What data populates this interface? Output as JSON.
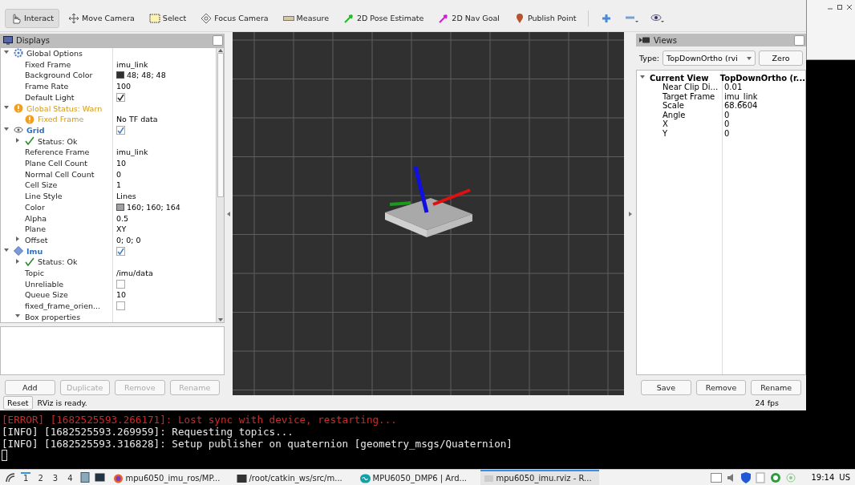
{
  "toolbar": {
    "tools": [
      {
        "kind": "interact",
        "label": "Interact",
        "selected": true
      },
      {
        "kind": "move",
        "label": "Move Camera",
        "selected": false
      },
      {
        "kind": "select",
        "label": "Select",
        "selected": false
      },
      {
        "kind": "focus",
        "label": "Focus Camera",
        "selected": false
      },
      {
        "kind": "measure",
        "label": "Measure",
        "selected": false
      },
      {
        "kind": "pose",
        "label": "2D Pose Estimate",
        "selected": false
      },
      {
        "kind": "nav",
        "label": "2D Nav Goal",
        "selected": false
      },
      {
        "kind": "point",
        "label": "Publish Point",
        "selected": false
      }
    ],
    "icon_tools": [
      {
        "kind": "plus"
      },
      {
        "kind": "minus"
      },
      {
        "kind": "eye"
      }
    ]
  },
  "displays": {
    "title": "Displays",
    "tree": [
      {
        "kind": "options",
        "label": "Global Options",
        "expanded": true,
        "children": [
          {
            "kind": "property",
            "label": "Fixed Frame",
            "value": "imu_link"
          },
          {
            "kind": "property",
            "label": "Background Color",
            "value": "48; 48; 48",
            "color": "#303030"
          },
          {
            "kind": "property",
            "label": "Frame Rate",
            "value": "100"
          },
          {
            "kind": "property",
            "label": "Default Light",
            "checked": true
          }
        ]
      },
      {
        "kind": "warn",
        "label": "Global Status: Warn",
        "expanded": true,
        "children": [
          {
            "kind": "warn",
            "label": "Fixed Frame",
            "value": "No TF data"
          }
        ]
      },
      {
        "kind": "grid",
        "label": "Grid",
        "expanded": true,
        "checked": true,
        "children": [
          {
            "kind": "status",
            "label": "Status: Ok",
            "expanded": false
          },
          {
            "kind": "property",
            "label": "Reference Frame",
            "value": "imu_link"
          },
          {
            "kind": "property",
            "label": "Plane Cell Count",
            "value": "10"
          },
          {
            "kind": "property",
            "label": "Normal Cell Count",
            "value": "0"
          },
          {
            "kind": "property",
            "label": "Cell Size",
            "value": "1"
          },
          {
            "kind": "property",
            "label": "Line Style",
            "value": "Lines"
          },
          {
            "kind": "property",
            "label": "Color",
            "value": "160; 160; 164",
            "color": "#a0a0a4"
          },
          {
            "kind": "property",
            "label": "Alpha",
            "value": "0.5"
          },
          {
            "kind": "property",
            "label": "Plane",
            "value": "XY"
          },
          {
            "kind": "property",
            "label": "Offset",
            "value": "0; 0; 0",
            "expanded": false
          }
        ]
      },
      {
        "kind": "imu",
        "label": "Imu",
        "expanded": true,
        "checked": true,
        "children": [
          {
            "kind": "status",
            "label": "Status: Ok",
            "expanded": false
          },
          {
            "kind": "property",
            "label": "Topic",
            "value": "/imu/data"
          },
          {
            "kind": "property",
            "label": "Unreliable",
            "checked": false
          },
          {
            "kind": "property",
            "label": "Queue Size",
            "value": "10"
          },
          {
            "kind": "property",
            "label": "fixed_frame_orien...",
            "checked": false
          },
          {
            "kind": "property",
            "label": "Box properties",
            "expanded": true
          }
        ]
      }
    ],
    "buttons": [
      {
        "label": "Add",
        "disabled": false
      },
      {
        "label": "Duplicate",
        "disabled": true
      },
      {
        "label": "Remove",
        "disabled": true
      },
      {
        "label": "Rename",
        "disabled": true
      }
    ]
  },
  "views": {
    "title": "Views",
    "type_label": "Type:",
    "type_value": "TopDownOrtho (rvi",
    "zero_button": "Zero",
    "tree": [
      {
        "label": "Current View",
        "value": "TopDownOrtho (r...",
        "expanded": true,
        "children": [
          {
            "label": "Near Clip Di...",
            "value": "0.01"
          },
          {
            "label": "Target Frame",
            "value": "imu_link"
          },
          {
            "label": "Scale",
            "value": "68.6604"
          },
          {
            "label": "Angle",
            "value": "0"
          },
          {
            "label": "X",
            "value": "0"
          },
          {
            "label": "Y",
            "value": "0"
          }
        ]
      }
    ],
    "buttons": [
      "Save",
      "Remove",
      "Rename"
    ]
  },
  "status_bar": {
    "reset_button": "Reset",
    "message": "RViz is ready.",
    "fps": "24 fps"
  },
  "terminal": {
    "lines": [
      {
        "kind": "error",
        "text": "[ERROR] [1682525593.266171]: Lost sync with device, restarting..."
      },
      {
        "kind": "info",
        "text": "[INFO] [1682525593.269959]: Requesting topics..."
      },
      {
        "kind": "info",
        "text": "[INFO] [1682525593.316828]: Setup publisher on quaternion [geometry_msgs/Quaternion]"
      }
    ]
  },
  "taskbar": {
    "workspaces": [
      {
        "label": "1",
        "selected": true
      },
      {
        "label": "2",
        "selected": false
      },
      {
        "label": "3",
        "selected": false
      },
      {
        "label": "4",
        "selected": false
      }
    ],
    "tasks": [
      {
        "kind": "browser",
        "label": "mpu6050_imu_ros/MP...",
        "selected": false
      },
      {
        "kind": "terminal",
        "label": "/root/catkin_ws/src/m...",
        "selected": false
      },
      {
        "kind": "arduino",
        "label": "MPU6050_DMP6 | Ard...",
        "selected": false
      },
      {
        "kind": "rviz",
        "label": "mpu6050_imu.rviz - R...",
        "selected": true
      }
    ],
    "clock": "19:14",
    "layout": "US"
  }
}
